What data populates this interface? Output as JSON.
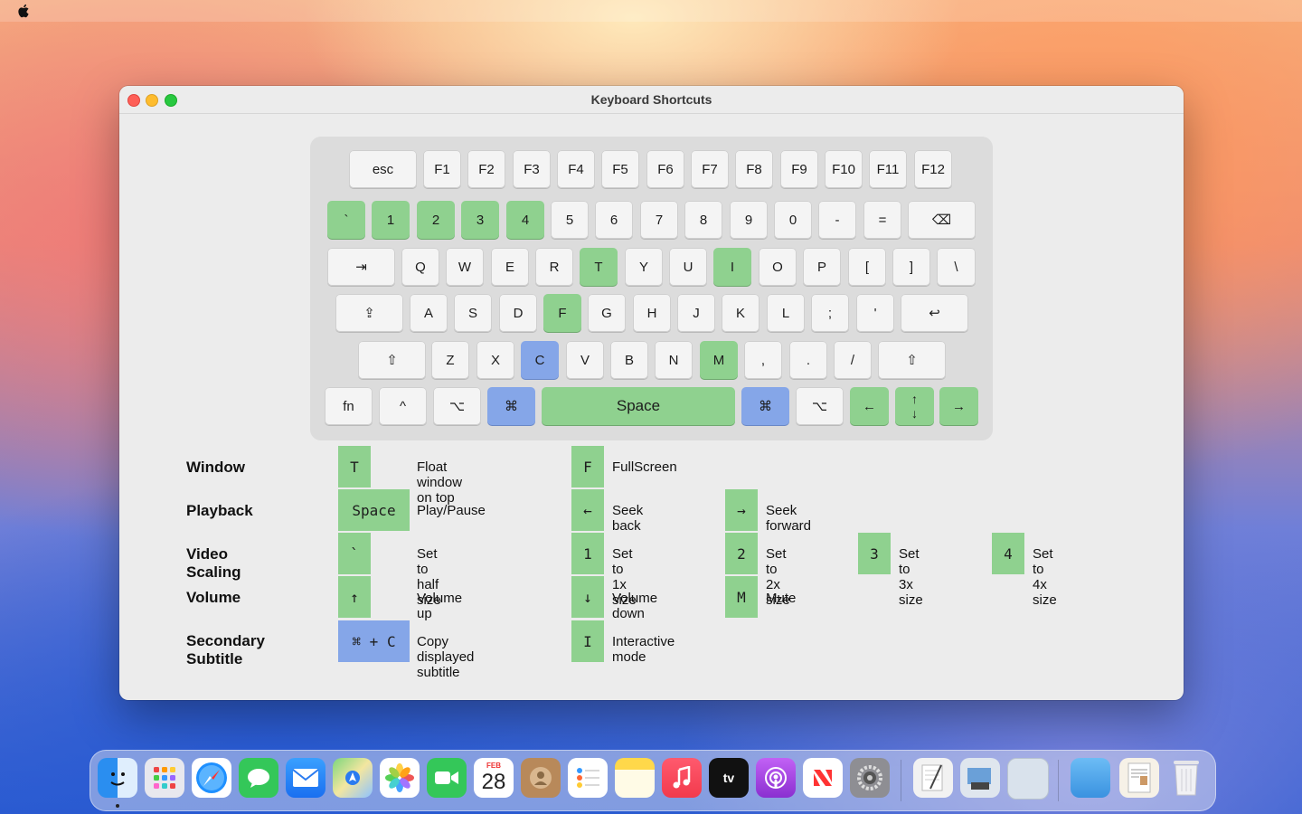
{
  "window": {
    "title": "Keyboard Shortcuts"
  },
  "keyboard": {
    "row0": [
      "esc",
      "F1",
      "F2",
      "F3",
      "F4",
      "F5",
      "F6",
      "F7",
      "F8",
      "F9",
      "F10",
      "F11",
      "F12"
    ],
    "row1": [
      "`",
      "1",
      "2",
      "3",
      "4",
      "5",
      "6",
      "7",
      "8",
      "9",
      "0",
      "-",
      "=",
      "⌫"
    ],
    "row2": [
      "⇥",
      "Q",
      "W",
      "E",
      "R",
      "T",
      "Y",
      "U",
      "I",
      "O",
      "P",
      "[",
      "]",
      "\\"
    ],
    "row3": [
      "⇪",
      "A",
      "S",
      "D",
      "F",
      "G",
      "H",
      "J",
      "K",
      "L",
      ";",
      "'",
      "↩"
    ],
    "row4": [
      "⇧",
      "Z",
      "X",
      "C",
      "V",
      "B",
      "N",
      "M",
      ",",
      ".",
      "/",
      "⇧"
    ],
    "row5": [
      "fn",
      "^",
      "⌥",
      "⌘",
      "Space",
      "⌘",
      "⌥",
      "←",
      "↑",
      "↓",
      "→"
    ]
  },
  "shortcuts": {
    "window": {
      "label": "Window",
      "k1": "T",
      "d1": "Float window on top",
      "k2": "F",
      "d2": "FullScreen"
    },
    "playback": {
      "label": "Playback",
      "k1": "Space",
      "d1": "Play/Pause",
      "k2": "←",
      "d2": "Seek back",
      "k3": "→",
      "d3": "Seek forward"
    },
    "scaling": {
      "label": "Video Scaling",
      "k1": "`",
      "d1": "Set to half size",
      "k2": "1",
      "d2": "Set to 1x size",
      "k3": "2",
      "d3": "Set to 2x size",
      "k4": "3",
      "d4": "Set to 3x size",
      "k5": "4",
      "d5": "Set to 4x size"
    },
    "volume": {
      "label": "Volume",
      "k1": "↑",
      "d1": "Volume up",
      "k2": "↓",
      "d2": "Volume down",
      "k3": "M",
      "d3": "Mute"
    },
    "subtitle": {
      "label": "Secondary Subtitle",
      "k1": "⌘ + C",
      "d1": "Copy displayed subtitle",
      "k2": "I",
      "d2": "Interactive mode"
    }
  },
  "dock": {
    "calendar_month": "FEB",
    "calendar_day": "28"
  },
  "colors": {
    "green": "#8fd18f",
    "blue": "#85a6e8"
  }
}
